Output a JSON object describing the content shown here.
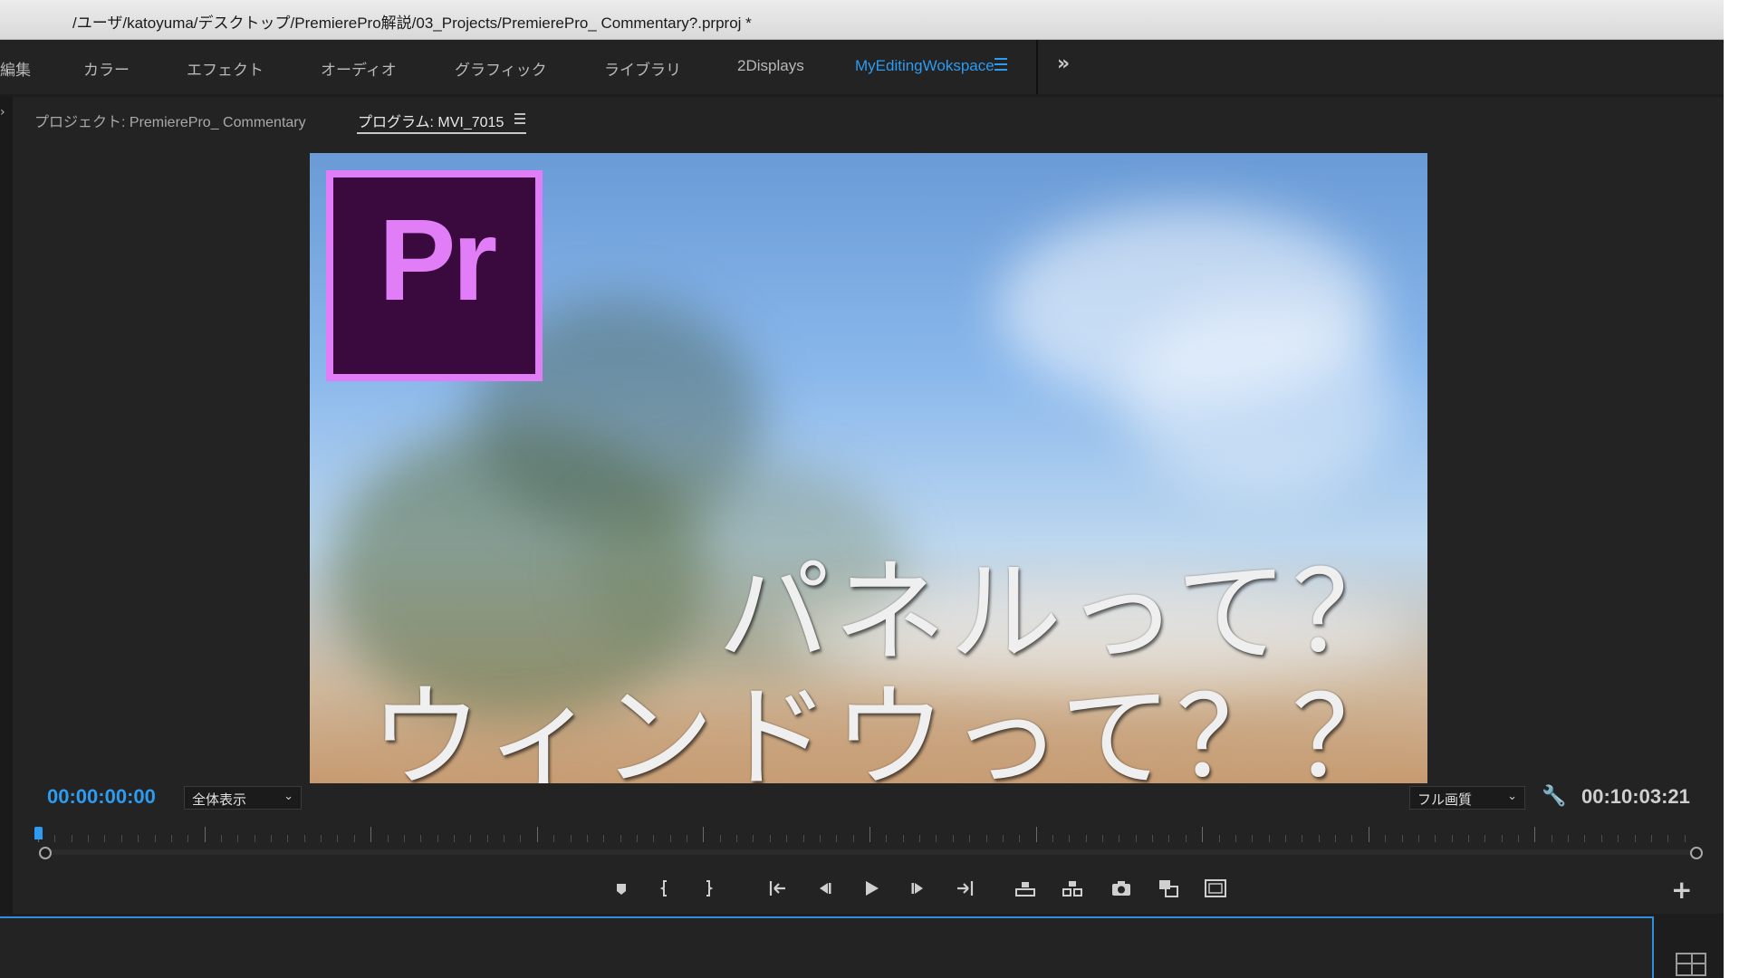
{
  "window": {
    "title": "/ユーザ/katoyuma/デスクトップ/PremierePro解説/03_Projects/PremierePro_ Commentary?.prproj *"
  },
  "workspaces": {
    "tabs": [
      {
        "label": "編集"
      },
      {
        "label": "カラー"
      },
      {
        "label": "エフェクト"
      },
      {
        "label": "オーディオ"
      },
      {
        "label": "グラフィック"
      },
      {
        "label": "ライブラリ"
      },
      {
        "label": "2Displays"
      },
      {
        "label": "MyEditingWokspace",
        "active": true
      }
    ],
    "overflow_icon": "double-chevron-right-icon",
    "menu_icon": "hamburger-icon",
    "active_color": "#2d9bf0"
  },
  "panels": {
    "project_tab": "プロジェクト: PremierePro_ Commentary",
    "program_tab": "プログラム: MVI_7015"
  },
  "monitor": {
    "logo_text": "Pr",
    "caption_line1": "パネルって？",
    "caption_line2": "ウィンドウって？？",
    "timecode_current": "00:00:00:00",
    "timecode_duration": "00:10:03:21",
    "zoom_select": "全体表示",
    "quality_select": "フル画質",
    "timecode_color": "#2d9bf0"
  },
  "controls": [
    {
      "name": "add-marker-button",
      "icon": "marker-icon"
    },
    {
      "name": "mark-in-button",
      "icon": "mark-in-icon"
    },
    {
      "name": "mark-out-button",
      "icon": "mark-out-icon"
    },
    {
      "name": "go-to-in-button",
      "icon": "go-to-in-icon"
    },
    {
      "name": "step-back-button",
      "icon": "step-back-icon"
    },
    {
      "name": "play-button",
      "icon": "play-icon"
    },
    {
      "name": "step-forward-button",
      "icon": "step-forward-icon"
    },
    {
      "name": "go-to-out-button",
      "icon": "go-to-out-icon"
    },
    {
      "name": "lift-button",
      "icon": "lift-icon"
    },
    {
      "name": "extract-button",
      "icon": "extract-icon"
    },
    {
      "name": "export-frame-button",
      "icon": "camera-icon"
    },
    {
      "name": "comparison-view-button",
      "icon": "comparison-icon"
    },
    {
      "name": "safe-margins-button",
      "icon": "safe-margins-icon"
    }
  ]
}
